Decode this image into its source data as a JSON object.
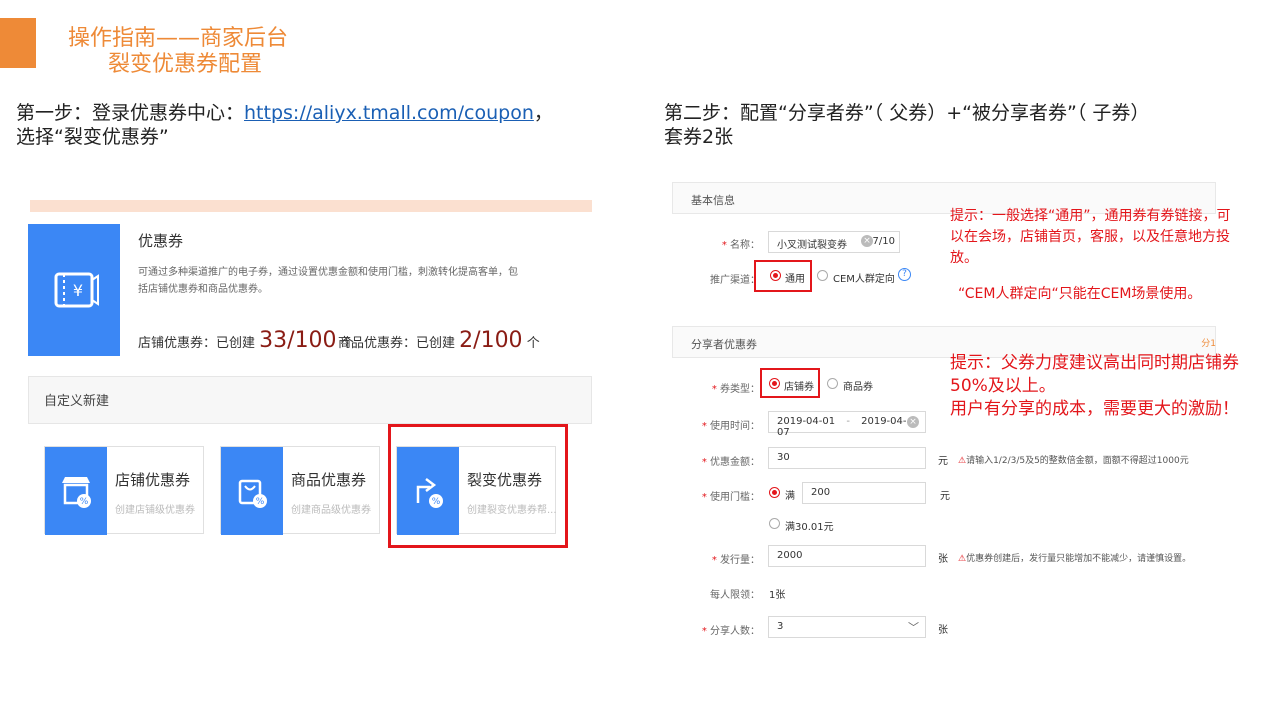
{
  "header": {
    "title_line1": "操作指南——商家后台",
    "title_line2": "裂变优惠券配置"
  },
  "step1": {
    "prefix": "第一步：登录优惠券中心：",
    "link": "https://aliyx.tmall.com/coupon",
    "suffix": "，",
    "line2": "选择“裂变优惠券”"
  },
  "step2": {
    "line1": "第二步：配置“分享者券”（ 父券）+“被分享者券”（ 子券）",
    "line2": "套券2张"
  },
  "coupon_center": {
    "title": "优惠券",
    "desc": "可通过多种渠道推广的电子券，通过设置优惠金额和使用门槛，刺激转化提高客单，包括店铺优惠券和商品优惠券。",
    "shop_label": "店铺优惠券：已创建",
    "shop_count": "33/100",
    "shop_unit": "个",
    "item_label": "商品优惠券：已创建",
    "item_count": "2/100",
    "item_unit": "个",
    "custom_label": "自定义新建",
    "cards": [
      {
        "name": "店铺优惠券",
        "sub": "创建店铺级优惠券",
        "icon": "store-percent-icon"
      },
      {
        "name": "商品优惠券",
        "sub": "创建商品级优惠券",
        "icon": "bag-percent-icon"
      },
      {
        "name": "裂变优惠券",
        "sub": "创建裂变优惠券帮...",
        "icon": "share-percent-icon"
      }
    ]
  },
  "form": {
    "basic_section": "基本信息",
    "name_label": "名称：",
    "name_value": "小叉测试裂变券",
    "name_count": "7/10",
    "channel_label": "推广渠道：",
    "channel_general": "通用",
    "channel_cem": "CEM人群定向",
    "sharer_section": "分享者优惠券",
    "corner_text": "分1",
    "type_label": "券类型：",
    "type_shop": "店铺券",
    "type_item": "商品券",
    "time_label": "使用时间：",
    "time_start": "2019-04-01",
    "time_sep": "-",
    "time_end": "2019-04-07",
    "amount_label": "优惠金额：",
    "amount_value": "30",
    "amount_unit": "元",
    "amount_hint": "请输入1/2/3/5及5的整数倍金额，面额不得超过1000元",
    "threshold_label": "使用门槛：",
    "threshold_full": "满",
    "threshold_value": "200",
    "threshold_unit": "元",
    "threshold_alt": "满30.01元",
    "issue_label": "发行量：",
    "issue_value": "2000",
    "issue_unit": "张",
    "issue_hint": "优惠券创建后，发行量只能增加不能减少，请谨慎设置。",
    "limit_label": "每人限领：",
    "limit_value": "1张",
    "share_label": "分享人数：",
    "share_value": "3",
    "share_unit": "张"
  },
  "tips": {
    "tip1": "提示：一般选择“通用”，通用券有券链接，可以在会场，店铺首页，客服，以及任意地方投放。",
    "tip1b": "“CEM人群定向“只能在CEM场景使用。",
    "tip2_line1": "提示：父券力度建议高出同时期店铺券50%及以上。",
    "tip2_line2": "用户有分享的成本，需要更大的激励！"
  },
  "colors": {
    "accent": "#ee8a37",
    "brand_blue": "#3b87f5",
    "alert_red": "#e3161b",
    "count_red": "#8a1c14"
  }
}
